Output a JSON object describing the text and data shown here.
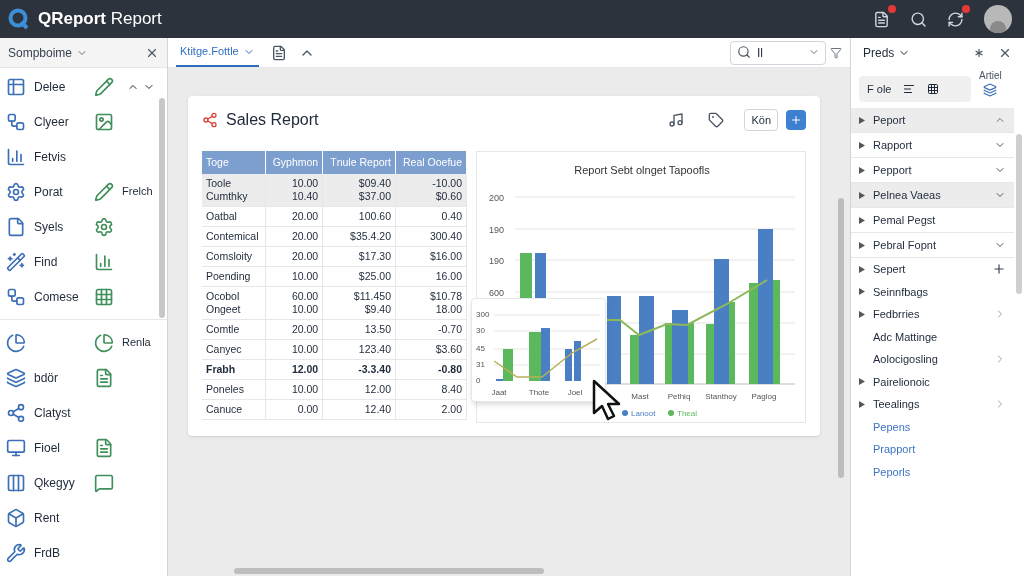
{
  "app": {
    "title": "**QReport** Report",
    "notification_badges": [
      true,
      false,
      true
    ]
  },
  "left_panel": {
    "title": "Sompboime",
    "items": [
      {
        "label": "Delee",
        "second_icon": true,
        "sort_controls": true
      },
      {
        "label": "Clyeer",
        "second_icon": true
      },
      {
        "label": "Fetvis",
        "second_icon": false
      },
      {
        "label": "Porat",
        "second_icon": true,
        "trailing_label": "Frelch"
      },
      {
        "label": "Syels",
        "second_icon": true
      },
      {
        "label": "Find",
        "second_icon": true
      },
      {
        "label": "Comese",
        "second_icon": true
      },
      {
        "kind": "divider"
      },
      {
        "second_icon": true,
        "trailing_label": "Renla"
      },
      {
        "label": "bdör",
        "second_icon": true
      },
      {
        "label": "Clatyst",
        "second_icon": false
      },
      {
        "label": "Fioel",
        "second_icon": true
      },
      {
        "label": "Qkegyy",
        "second_icon": true
      },
      {
        "label": "Rent",
        "second_icon": false
      },
      {
        "label": "FrdB",
        "second_icon": false
      }
    ]
  },
  "toolbar": {
    "tabs": [
      {
        "label": "Ktitge.Fottle",
        "selected": true
      }
    ],
    "search": {
      "value": "Il"
    }
  },
  "card": {
    "title": "Sales Report",
    "action_button": "Kön",
    "table": {
      "columns": [
        "Toge",
        "Gyphmon",
        "Tnule Report",
        "Real Ooefue"
      ],
      "rows": [
        {
          "cells": [
            "Toole\nCumthky",
            "10.00\n10.40",
            "$09.40\n$37.00",
            "-10.00\n$0.60"
          ],
          "shaded": true,
          "bold": false
        },
        {
          "cells": [
            "Oatbal",
            "20.00",
            "100.60",
            "0.40"
          ],
          "shaded": false,
          "bold": false
        },
        {
          "cells": [
            "Contemical",
            "20.00",
            "$35.4.20",
            "300.40"
          ],
          "shaded": false,
          "bold": false
        },
        {
          "cells": [
            "Comsloity",
            "20.00",
            "$17.30",
            "$16.00"
          ],
          "shaded": false,
          "bold": false
        },
        {
          "cells": [
            "Poending",
            "10.00",
            "$25.00",
            "16.00"
          ],
          "shaded": false,
          "bold": false
        },
        {
          "cells": [
            "Ocobol\nOngeet",
            "60.00\n10.00",
            "$11.450\n$9.40",
            "$10.78\n18.00"
          ],
          "shaded": false,
          "bold": false
        },
        {
          "cells": [
            "Comtle",
            "20.00",
            "13.50",
            "-0.70"
          ],
          "shaded": false,
          "bold": false
        },
        {
          "cells": [
            "Canyec",
            "10.00",
            "123.40",
            "$3.60"
          ],
          "shaded": false,
          "bold": false
        },
        {
          "cells": [
            "Frabh",
            "12.00",
            "-3.3.40",
            "-0.80"
          ],
          "shaded": false,
          "bold": true
        },
        {
          "cells": [
            "Poneles",
            "10.00",
            "12.00",
            "8.40"
          ],
          "shaded": false,
          "bold": false
        },
        {
          "cells": [
            "Canuce",
            "0.00",
            "12.40",
            "2.00"
          ],
          "shaded": false,
          "bold": false
        }
      ]
    },
    "chart": {
      "title": "Report Sebt olnget Tapoofls",
      "y_labels": [
        "200",
        "190",
        "190",
        "600"
      ],
      "x_labels": [
        "Mast",
        "Pethiq",
        "Stanthoy",
        "Paglog"
      ],
      "legend": [
        {
          "label": "Lanoot",
          "color": "#4a7fc4"
        },
        {
          "label": "Theal",
          "color": "#5cb85c"
        }
      ]
    },
    "inset_chart": {
      "y_labels": [
        "300",
        "30",
        "45",
        "31",
        "0"
      ],
      "x_labels": [
        "Jaat",
        "Thote",
        "Joel"
      ]
    }
  },
  "right_panel": {
    "title": "Preds",
    "toolbar_label": "F ole",
    "side_label": "Artiel",
    "items": [
      {
        "label": "Peport",
        "kind": "section",
        "shaded": true,
        "collapsible": true,
        "expanded": true
      },
      {
        "label": "Rapport",
        "kind": "section",
        "shaded": false,
        "collapsible": true,
        "expanded": false
      },
      {
        "label": "Pepport",
        "kind": "section",
        "shaded": false,
        "collapsible": true,
        "expanded": false
      },
      {
        "label": "Pelnea Vaeas",
        "kind": "section",
        "shaded": true,
        "collapsible": true,
        "expanded": false
      },
      {
        "label": "Pemal Pegst",
        "kind": "section",
        "shaded": false,
        "collapsible": false
      },
      {
        "label": "Pebral Fopnt",
        "kind": "section",
        "shaded": false,
        "collapsible": true,
        "expanded": false
      },
      {
        "label": "Sepert",
        "kind": "entry",
        "arrow": true,
        "addable": true,
        "has_submenu": false
      },
      {
        "label": "Seinnfbags",
        "kind": "entry",
        "arrow": true,
        "addable": false,
        "has_submenu": false
      },
      {
        "label": "Fedbrries",
        "kind": "entry",
        "arrow": true,
        "addable": false,
        "has_submenu": true
      },
      {
        "label": "Adc Mattinge",
        "kind": "entry",
        "arrow": false,
        "addable": false,
        "has_submenu": false
      },
      {
        "label": "Aolocigosling",
        "kind": "entry",
        "arrow": false,
        "addable": false,
        "has_submenu": true
      },
      {
        "label": "Pairelionoic",
        "kind": "entry",
        "arrow": true,
        "addable": false,
        "has_submenu": false
      },
      {
        "label": "Teealings",
        "kind": "entry",
        "arrow": true,
        "addable": false,
        "has_submenu": true
      },
      {
        "label": "Pepens",
        "kind": "link"
      },
      {
        "label": "Prapport",
        "kind": "link"
      },
      {
        "label": "Peporls",
        "kind": "link"
      }
    ]
  }
}
